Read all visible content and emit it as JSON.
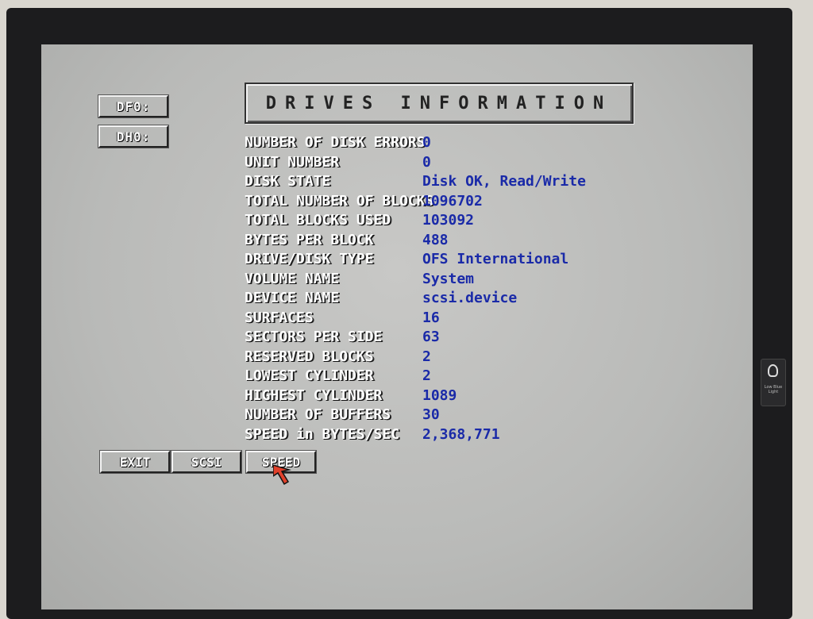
{
  "title": "DRIVES INFORMATION",
  "drives": [
    {
      "label": "DF0:"
    },
    {
      "label": "DH0:"
    }
  ],
  "info_rows": [
    {
      "label": "NUMBER OF DISK ERRORS",
      "value": "0"
    },
    {
      "label": "UNIT NUMBER",
      "value": "0"
    },
    {
      "label": "DISK STATE",
      "value": "Disk OK, Read/Write"
    },
    {
      "label": "TOTAL NUMBER OF BLOCKS",
      "value": "1096702"
    },
    {
      "label": "TOTAL BLOCKS USED",
      "value": "103092"
    },
    {
      "label": "BYTES PER BLOCK",
      "value": "488"
    },
    {
      "label": "DRIVE/DISK TYPE",
      "value": "OFS International"
    },
    {
      "label": "VOLUME NAME",
      "value": "System"
    },
    {
      "label": "DEVICE NAME",
      "value": "scsi.device"
    },
    {
      "label": "SURFACES",
      "value": "16"
    },
    {
      "label": "SECTORS PER SIDE",
      "value": "63"
    },
    {
      "label": "RESERVED BLOCKS",
      "value": "2"
    },
    {
      "label": "LOWEST CYLINDER",
      "value": "2"
    },
    {
      "label": "HIGHEST CYLINDER",
      "value": "1089"
    },
    {
      "label": "NUMBER OF BUFFERS",
      "value": "30"
    },
    {
      "label": "SPEED in BYTES/SEC",
      "value": "2,368,771"
    }
  ],
  "buttons": {
    "exit": "EXIT",
    "scsi": "SCSI",
    "speed": "SPEED"
  },
  "monitor_icon": {
    "name": "lightbulb-icon",
    "text": "Low Blue Light"
  },
  "colors": {
    "screen_bg": "#c4c4c2",
    "label_text": "#ffffff",
    "value_text": "#1a2aa8",
    "bezel": "#1c1c1e",
    "pointer": "#e0402a"
  }
}
